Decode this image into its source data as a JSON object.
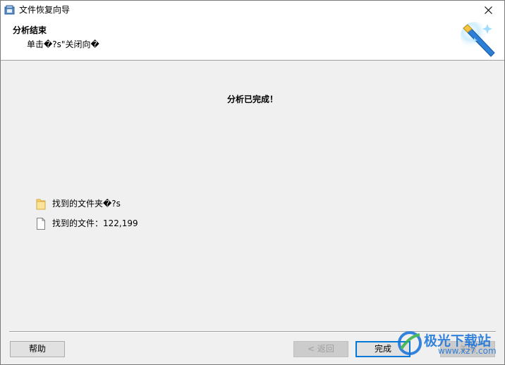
{
  "window": {
    "title": "文件恢复向导"
  },
  "header": {
    "title": "分析结束",
    "subtitle": "单击�?s\"关闭向�"
  },
  "body": {
    "complete_message": "分析已完成！",
    "results": [
      {
        "icon": "folder-icon",
        "label": "找到的文件夹�?s"
      },
      {
        "icon": "file-icon",
        "label": "找到的文件：122,199"
      }
    ]
  },
  "buttons": {
    "help": "帮助",
    "back": "< 返回",
    "finish": "完成",
    "close": "关闭"
  },
  "watermark": {
    "brand": "极光下载站",
    "url": "www.xz7.com"
  },
  "colors": {
    "accent": "#0078d7",
    "background": "#f0f0f0",
    "folder": "#f7d774"
  }
}
